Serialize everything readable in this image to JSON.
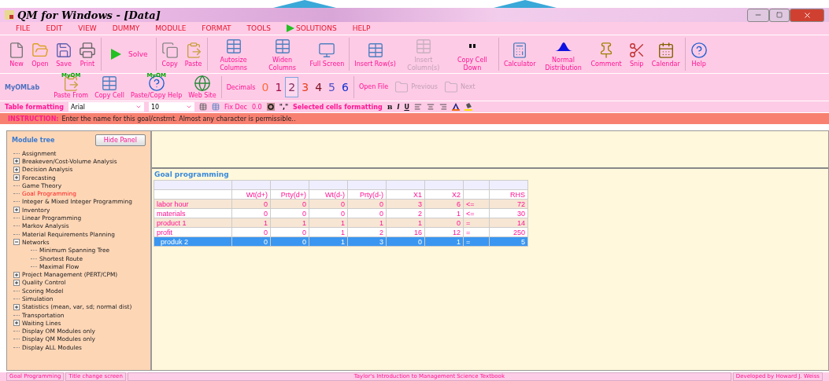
{
  "window": {
    "title": "QM for Windows - [Data]"
  },
  "menu": [
    {
      "label": "FILE",
      "kind": "plain"
    },
    {
      "label": "EDIT",
      "kind": "plain"
    },
    {
      "label": "VIEW",
      "kind": "plain"
    },
    {
      "label": "DUMMY",
      "kind": "plain"
    },
    {
      "label": "MODULE",
      "kind": "plain"
    },
    {
      "label": "FORMAT",
      "kind": "plain"
    },
    {
      "label": "TOOLS",
      "kind": "plain"
    },
    {
      "label": "SOLUTIONS",
      "kind": "play"
    },
    {
      "label": "HELP",
      "kind": "plain"
    }
  ],
  "toolbar": [
    {
      "label": "New",
      "disabled": false
    },
    {
      "label": "Open",
      "disabled": false
    },
    {
      "label": "Save",
      "disabled": false
    },
    {
      "label": "Print",
      "disabled": false
    },
    {
      "label": "Solve",
      "disabled": false
    },
    {
      "label": "Copy",
      "disabled": false
    },
    {
      "label": "Paste",
      "disabled": false
    },
    {
      "label": "Autosize Columns",
      "disabled": false
    },
    {
      "label": "Widen Columns",
      "disabled": false
    },
    {
      "label": "Full Screen",
      "disabled": false
    },
    {
      "label": "Insert Row(s)",
      "disabled": false
    },
    {
      "label": "Insert Column(s)",
      "disabled": true
    },
    {
      "label": "Copy Cell Down",
      "disabled": false
    },
    {
      "label": "Calculator",
      "disabled": false
    },
    {
      "label": "Normal Distribution",
      "disabled": false
    },
    {
      "label": "Comment",
      "disabled": false
    },
    {
      "label": "Snip",
      "disabled": false
    },
    {
      "label": "Calendar",
      "disabled": false
    },
    {
      "label": "Help",
      "disabled": false
    }
  ],
  "toolbar2": {
    "label": "MyOMLab",
    "buttons": [
      {
        "label": "Paste From",
        "badge": "MyOM"
      },
      {
        "label": "Copy Cell"
      },
      {
        "label": "Paste/Copy Help",
        "badge": "MyOM"
      },
      {
        "label": "Web Site"
      }
    ],
    "decimals_label": "Decimals",
    "decimals": [
      {
        "label": "0",
        "color": "#ff6a3a",
        "selected": false
      },
      {
        "label": "1",
        "color": "#a0104a",
        "selected": false
      },
      {
        "label": "2",
        "color": "#803060",
        "selected": true
      },
      {
        "label": "3",
        "color": "#e8401a",
        "selected": false
      },
      {
        "label": "4",
        "color": "#801020",
        "selected": false
      },
      {
        "label": "5",
        "color": "#5050c8",
        "selected": false
      },
      {
        "label": "6",
        "color": "#1030d0",
        "selected": false
      }
    ],
    "file_buttons": [
      {
        "label": "Open File",
        "disabled": false
      },
      {
        "label": "Previous",
        "disabled": true
      },
      {
        "label": "Next",
        "disabled": true
      }
    ]
  },
  "format_bar": {
    "label": "Table formatting",
    "font": "Arial",
    "size": "10",
    "fix_dec_label": "Fix Dec",
    "fix_dec_value": "0.0",
    "comma": "\",\"",
    "selected_label": "Selected cells formatting",
    "bold": "B",
    "italic": "I",
    "underline": "U"
  },
  "instruction": {
    "label": "INSTRUCTION:",
    "text": "Enter the name for this goal/cnstrnt. Almost any character is permissible.."
  },
  "module_tree": {
    "title": "Module tree",
    "hide_button": "Hide Panel",
    "items": [
      {
        "label": "Assignment",
        "kind": "leaf",
        "selected": false
      },
      {
        "label": "Breakeven/Cost-Volume Analysis",
        "kind": "group",
        "expanded": false,
        "selected": false
      },
      {
        "label": "Decision Analysis",
        "kind": "group",
        "expanded": false,
        "selected": false
      },
      {
        "label": "Forecasting",
        "kind": "group",
        "expanded": false,
        "selected": false
      },
      {
        "label": "Game Theory",
        "kind": "leaf",
        "selected": false
      },
      {
        "label": "Goal Programming",
        "kind": "leaf",
        "selected": true
      },
      {
        "label": "Integer & Mixed Integer Programming",
        "kind": "leaf",
        "selected": false
      },
      {
        "label": "Inventory",
        "kind": "group",
        "expanded": false,
        "selected": false
      },
      {
        "label": "Linear Programming",
        "kind": "leaf",
        "selected": false
      },
      {
        "label": "Markov Analysis",
        "kind": "leaf",
        "selected": false
      },
      {
        "label": "Material Requirements Planning",
        "kind": "leaf",
        "selected": false
      },
      {
        "label": "Networks",
        "kind": "group",
        "expanded": true,
        "selected": false,
        "children": [
          {
            "label": "Minimum Spanning Tree",
            "kind": "leaf",
            "selected": false
          },
          {
            "label": "Shortest Route",
            "kind": "leaf",
            "selected": false
          },
          {
            "label": "Maximal Flow",
            "kind": "leaf",
            "selected": false
          }
        ]
      },
      {
        "label": "Project Management (PERT/CPM)",
        "kind": "group",
        "expanded": false,
        "selected": false
      },
      {
        "label": "Quality Control",
        "kind": "group",
        "expanded": false,
        "selected": false
      },
      {
        "label": "Scoring Model",
        "kind": "leaf",
        "selected": false
      },
      {
        "label": "Simulation",
        "kind": "leaf",
        "selected": false
      },
      {
        "label": "Statistics (mean, var, sd; normal dist)",
        "kind": "group",
        "expanded": false,
        "selected": false
      },
      {
        "label": "Transportation",
        "kind": "leaf",
        "selected": false
      },
      {
        "label": "Waiting Lines",
        "kind": "group",
        "expanded": false,
        "selected": false
      },
      {
        "label": "Display OM Modules only",
        "kind": "leaf",
        "selected": false
      },
      {
        "label": "Display QM Modules only",
        "kind": "leaf",
        "selected": false
      },
      {
        "label": "Display ALL Modules",
        "kind": "leaf",
        "selected": false
      }
    ]
  },
  "table": {
    "title": "Goal programming",
    "columns": [
      "Wt(d+)",
      "Prty(d+)",
      "Wt(d-)",
      "Prty(d-)",
      "X1",
      "X2",
      "RHS"
    ],
    "rows": [
      {
        "name": "labor hour",
        "values": [
          "0",
          "0",
          "0",
          "0",
          "3",
          "6"
        ],
        "sign": "<=",
        "rhs": "72",
        "selected": false
      },
      {
        "name": "materials",
        "values": [
          "0",
          "0",
          "0",
          "0",
          "2",
          "1"
        ],
        "sign": "<=",
        "rhs": "30",
        "selected": false
      },
      {
        "name": "product 1",
        "values": [
          "1",
          "1",
          "1",
          "1",
          "1",
          "0"
        ],
        "sign": "=",
        "rhs": "14",
        "selected": false
      },
      {
        "name": "profit",
        "values": [
          "0",
          "0",
          "1",
          "2",
          "16",
          "12"
        ],
        "sign": "=",
        "rhs": "250",
        "selected": false
      },
      {
        "name": "produk 2",
        "values": [
          "0",
          "0",
          "1",
          "3",
          "0",
          "1"
        ],
        "sign": "=",
        "rhs": "5",
        "selected": true
      }
    ]
  },
  "status_bar": [
    "Goal Programming",
    "Title change screen",
    "Taylor's Introduction to Management Science Textbook",
    "Developed by Howard J. Weiss"
  ]
}
